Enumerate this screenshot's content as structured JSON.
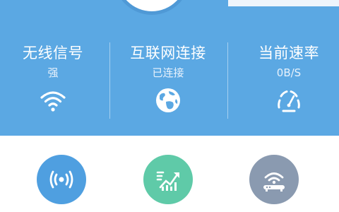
{
  "status": {
    "signal": {
      "title": "无线信号",
      "value": "强",
      "icon": "wifi-icon"
    },
    "internet": {
      "title": "互联网连接",
      "value": "已连接",
      "icon": "globe-icon"
    },
    "speed": {
      "title": "当前速率",
      "value": "0B/S",
      "icon": "speedometer-icon"
    }
  },
  "actions": [
    {
      "icon": "broadcast-icon",
      "color": "#4f9fe0"
    },
    {
      "icon": "speed-boost-icon",
      "color": "#5fcaa8"
    },
    {
      "icon": "router-icon",
      "color": "#8a9ab0"
    }
  ],
  "colors": {
    "panel": "#5ba8e3",
    "text": "#ffffff"
  }
}
